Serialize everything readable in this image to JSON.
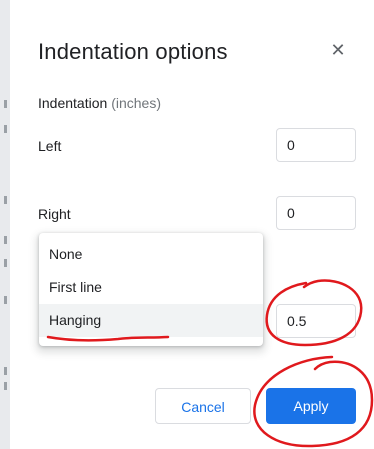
{
  "dialog": {
    "title": "Indentation options",
    "close_icon": "close-icon",
    "section_label": "Indentation",
    "section_unit": "(inches)",
    "left": {
      "label": "Left",
      "value": "0"
    },
    "right": {
      "label": "Right",
      "value": "0"
    },
    "special": {
      "value": "0.5"
    },
    "special_menu": {
      "options": [
        "None",
        "First line",
        "Hanging"
      ],
      "selected": "Hanging"
    },
    "buttons": {
      "cancel": "Cancel",
      "apply": "Apply"
    }
  },
  "colors": {
    "accent": "#1a73e8",
    "annotation": "#e0191d",
    "text": "#202124",
    "muted": "#70757a"
  }
}
